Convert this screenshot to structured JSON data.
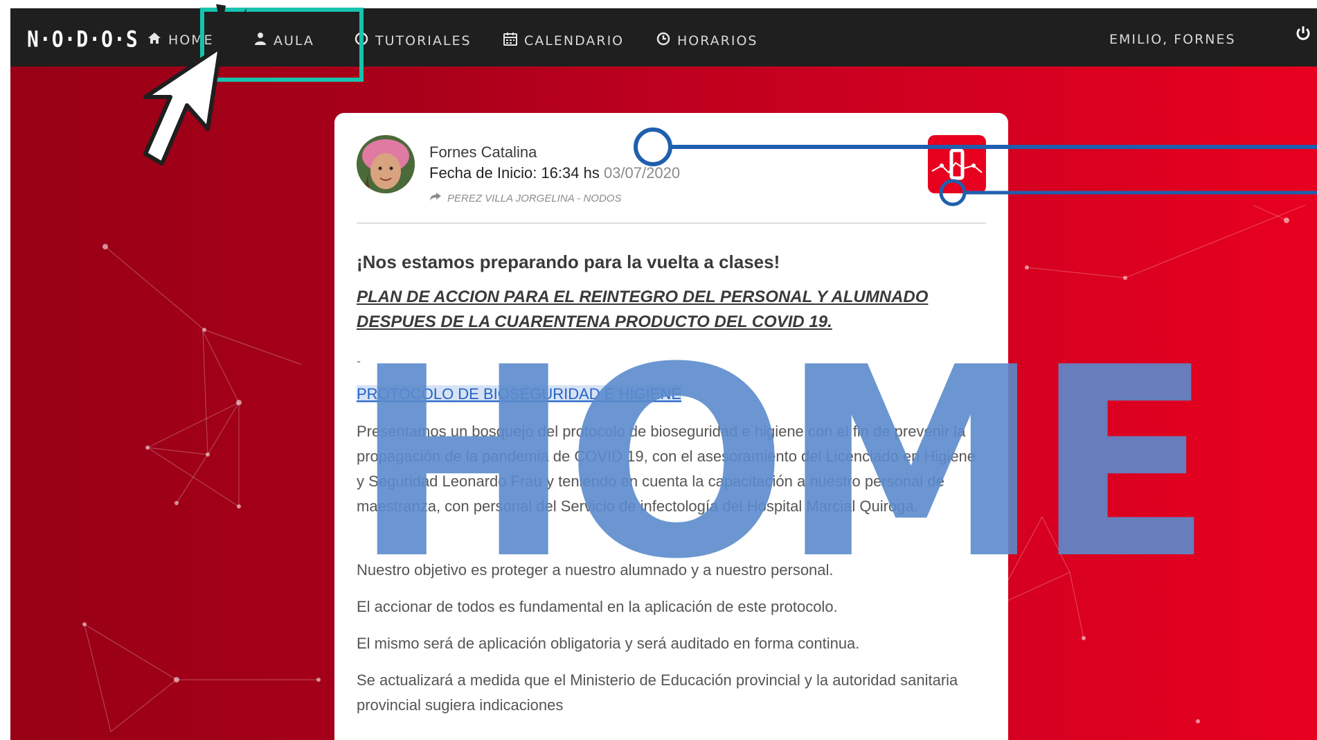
{
  "navbar": {
    "brand": "N·O·D·O·S",
    "items": [
      {
        "label": "HOME",
        "icon": "home-icon"
      },
      {
        "label": "AULA",
        "icon": "user-icon"
      },
      {
        "label": "TUTORIALES",
        "icon": "help-circle-icon"
      },
      {
        "label": "CALENDARIO",
        "icon": "calendar-icon"
      },
      {
        "label": "HORARIOS",
        "icon": "clock-icon"
      }
    ],
    "user": "EMILIO, FORNES",
    "power_icon": "power-icon"
  },
  "post": {
    "author": "Fornes Catalina",
    "start_label": "Fecha de Inicio: 16:34 hs",
    "start_date": "03/07/2020",
    "shared_by": "PEREZ VILLA JORGELINA - NODOS",
    "title": "¡Nos estamos preparando para la vuelta a clases!",
    "plan": "PLAN DE ACCION PARA EL REINTEGRO DEL PERSONAL Y ALUMNADO DESPUES DE LA CUARENTENA PRODUCTO DEL COVID 19.",
    "dash": "-",
    "protocol_link": "PROTOCOLO DE BIOSEGURIDAD E HIGIENE",
    "paragraphs": [
      "Presentamos un bosquejo del protocolo de bioseguridad e higiene con el fin de prevenir la propagación de la pandemia de COVID 19, con el asesoramiento del Licenciado en Higiene y Seguridad Leonardo Frau  y teniendo en cuenta la capacitación a nuestro personal de maestranza, con personal del Servicio  de infectología  del Hospital Marcial Quiroga.",
      " Nuestro objetivo es proteger a nuestro alumnado y a nuestro personal.",
      "El accionar de todos es fundamental en la aplicación de este protocolo.",
      "El mismo será de aplicación obligatoria y será auditado en forma continua.",
      "Se actualizará a medida que el Ministerio de Educación provincial  y la autoridad sanitaria provincial sugiera indicaciones"
    ]
  },
  "overlay_text": "HOME",
  "colors": {
    "navbar": "#1f1f1f",
    "hero_red": "#cc0020",
    "highlight_box": "#17c3ae",
    "callout_line": "#1f5fae",
    "overlay_blue": "#5b8bcc"
  }
}
